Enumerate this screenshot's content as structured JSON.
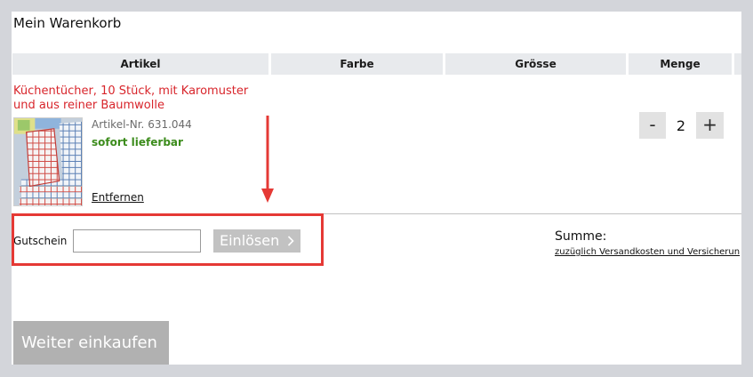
{
  "page": {
    "title": "Mein Warenkorb"
  },
  "cart": {
    "columns": [
      "Artikel",
      "Farbe",
      "Grösse",
      "Menge"
    ],
    "items": [
      {
        "name": "Küchentücher, 10 Stück, mit Karomuster und aus reiner Baumwolle",
        "image_icon": "kitchen-towels-product-image",
        "article_no": "Artikel-Nr. 631.044",
        "availability": "sofort lieferbar",
        "remove_label": "Entfernen",
        "decrement_label": "-",
        "quantity": "2",
        "increment_label": "+"
      }
    ]
  },
  "voucher": {
    "label": "Gutschein",
    "value": "",
    "placeholder": "",
    "redeem_label": "Einlösen",
    "redeem_icon": "chevron-right-icon"
  },
  "summary": {
    "sum_label": "Summe:",
    "shipping_note": "zuzüglich Versandkosten und Versicherun"
  },
  "actions": {
    "continue_label": "Weiter einkaufen"
  },
  "theme": {
    "page_bg": "#d3d5da",
    "header_gray": "#e8eaed",
    "title_red": "#d8252b",
    "stock_green": "#3c8c1c",
    "stepper_gray": "#e2e2e2",
    "button_gray": "#c2c2c2",
    "continue_gray": "#b1b1b1",
    "annotation_red": "#e53935"
  }
}
